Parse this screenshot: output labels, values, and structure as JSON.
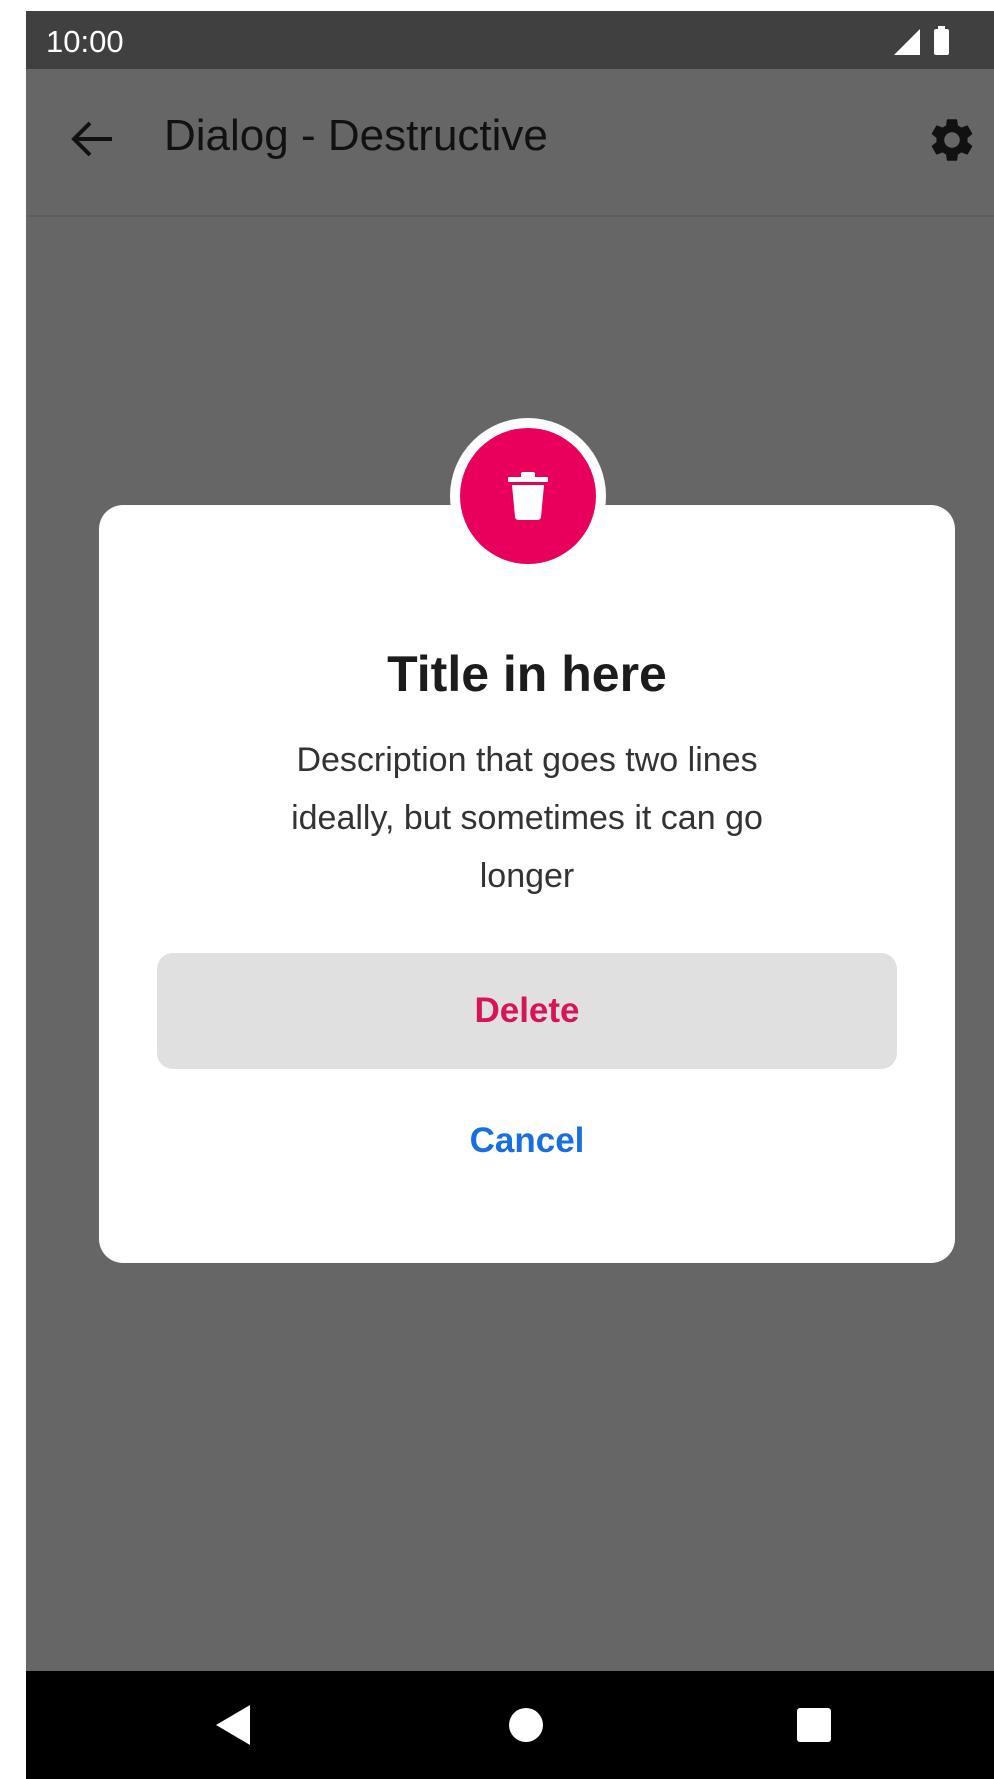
{
  "status_bar": {
    "time": "10:00",
    "signal_icon": "signal-icon",
    "battery_icon": "battery-icon"
  },
  "app_bar": {
    "title": "Dialog - Destructive",
    "back_icon": "arrow-back-icon",
    "settings_icon": "gear-icon"
  },
  "dialog": {
    "icon": "trash-icon",
    "title": "Title in here",
    "description": "Description that goes two lines ideally, but sometimes it can go longer",
    "delete_label": "Delete",
    "cancel_label": "Cancel"
  },
  "nav_bar": {
    "back_icon": "nav-back-icon",
    "home_icon": "nav-home-icon",
    "recents_icon": "nav-recents-icon"
  },
  "colors": {
    "destructive": "#e8005c",
    "delete_text": "#d6145a",
    "cancel_text": "#1a6fe0",
    "scrim": "#666666"
  }
}
